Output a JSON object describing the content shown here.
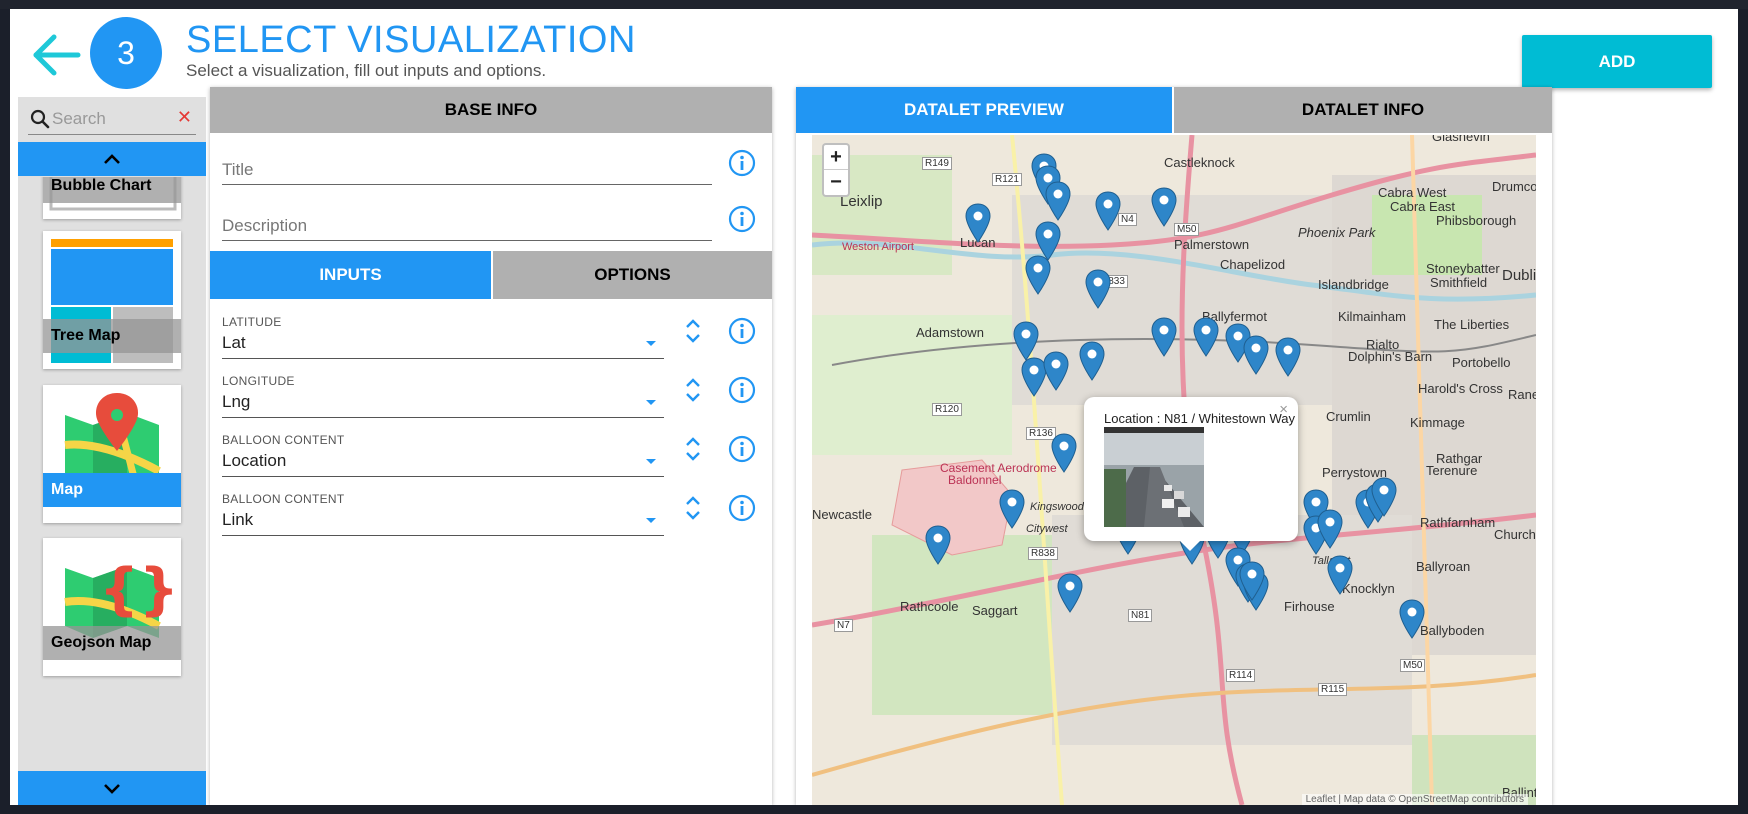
{
  "header": {
    "step_number": "3",
    "title": "SELECT VISUALIZATION",
    "subtitle": "Select a visualization, fill out inputs and options.",
    "add_label": "ADD"
  },
  "sidebar": {
    "search_placeholder": "Search",
    "items": [
      {
        "label": "Bubble Chart"
      },
      {
        "label": "Tree Map"
      },
      {
        "label": "Map",
        "selected": true
      },
      {
        "label": "Geojson Map"
      }
    ]
  },
  "base_info": {
    "header": "BASE INFO",
    "title_placeholder": "Title",
    "description_placeholder": "Description"
  },
  "config_tabs": {
    "inputs_label": "INPUTS",
    "options_label": "OPTIONS",
    "active": "INPUTS"
  },
  "inputs": [
    {
      "label": "LATITUDE",
      "value": "Lat"
    },
    {
      "label": "LONGITUDE",
      "value": "Lng"
    },
    {
      "label": "BALLOON CONTENT",
      "value": "Location"
    },
    {
      "label": "BALLOON CONTENT",
      "value": "Link"
    }
  ],
  "preview_tabs": {
    "preview_label": "DATALET PREVIEW",
    "info_label": "DATALET INFO",
    "active": "DATALET PREVIEW"
  },
  "map": {
    "zoom_in": "+",
    "zoom_out": "−",
    "popup_text": "Location : N81 / Whitestown Way",
    "popup_close": "×",
    "attribution": "Leaflet | Map data © OpenStreetMap contributors",
    "places": [
      "Leixlip",
      "Castleknock",
      "Cabra West",
      "Cabra East",
      "Phibsborough",
      "Phoenix Park",
      "Stoneybatter",
      "Smithfield",
      "Dublin",
      "Islandbridge",
      "Chapelizod",
      "Palmerstown",
      "Adamstown",
      "Ballyfermot",
      "Kilmainham",
      "The Liberties",
      "Rialto",
      "Dolphin's Barn",
      "Portobello",
      "Harold's Cross",
      "Ranelagh",
      "Crumlin",
      "Kimmage",
      "Rathgar",
      "Terenure",
      "Perrystown",
      "Casement Aerodrome",
      "Baldonnel",
      "Kingswood",
      "Citywest",
      "Saggart",
      "Rathcoole",
      "Firhouse",
      "Knocklyn",
      "Ballyroan",
      "Ballyboden",
      "Churchtown",
      "Rathfarnham",
      "Weston Airport",
      "Lucan",
      "Newcastle",
      "Glasnevin",
      "Drumcondra",
      "Ballinteer",
      "Tallaght"
    ],
    "roads": [
      "R149",
      "R121",
      "N4",
      "M50",
      "R833",
      "R120",
      "R136",
      "R838",
      "N7",
      "N81",
      "R114",
      "R115",
      "M50"
    ],
    "accent_color": "#2196f3",
    "marker_color": "#2e86c9"
  }
}
